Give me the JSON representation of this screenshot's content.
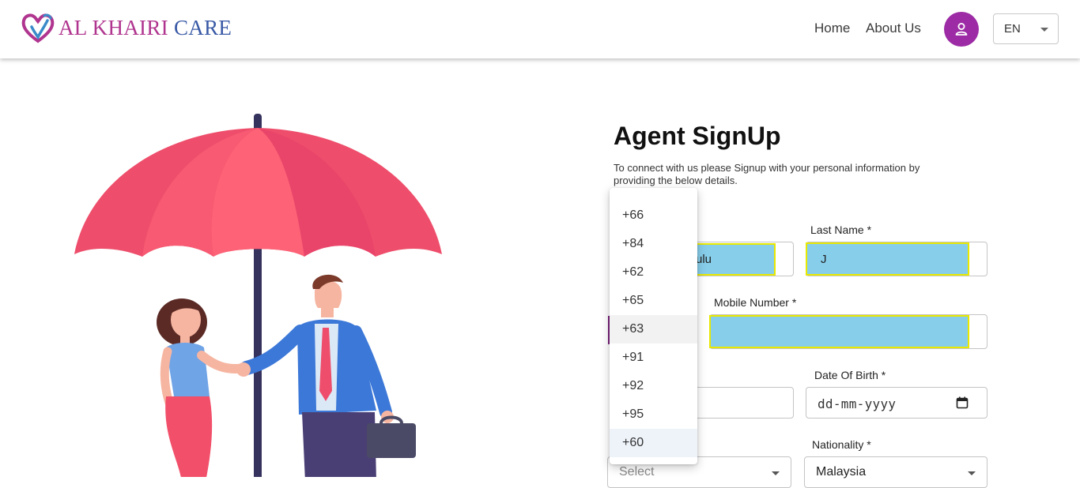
{
  "header": {
    "logo_part1": "AL KHAIRI",
    "logo_part2": "CARE",
    "nav": [
      {
        "label": "Home"
      },
      {
        "label": "About Us"
      }
    ],
    "language": "EN"
  },
  "colors": {
    "brand_pink": "#b0358f",
    "brand_blue": "#3a5aa6",
    "avatar_purple": "#9c2ba5",
    "autofill": "#87ceeb"
  },
  "form": {
    "title": "Agent SignUp",
    "description": "To connect with us please Signup with your personal information by providing the below details.",
    "first_name_value": "ulu",
    "last_name_label": "Last Name *",
    "last_name_value": "J",
    "mobile_label": "Mobile Number *",
    "mobile_value": "",
    "dob_label": "Date Of Birth *",
    "dob_placeholder": "dd-mm-yyyy",
    "gender_placeholder": "Select",
    "nationality_label": "Nationality *",
    "nationality_value": "Malaysia"
  },
  "country_code_dropdown": {
    "options": [
      "+66",
      "+84",
      "+62",
      "+65",
      "+63",
      "+91",
      "+92",
      "+95",
      "+60"
    ],
    "hovered": "+63",
    "selected": "+60"
  }
}
